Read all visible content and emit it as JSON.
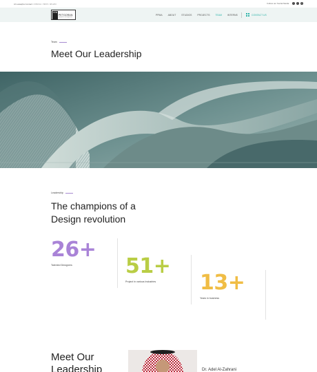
{
  "topbar": {
    "contact_label": "Al Lawaqha Contact:",
    "contact_number": "2350941 / 8835 / 981260",
    "social_label": "Follow our Social Media:",
    "social_icons": [
      "facebook-icon",
      "twitter-icon",
      "instagram-icon"
    ]
  },
  "navbar": {
    "logo_mark": "PPM",
    "logo_name": "PETGORAN",
    "logo_sub": "petgoran management",
    "items": [
      "PPMA",
      "ABOUT",
      "STUDIOS",
      "PROJECTS",
      "TEAM",
      "INTERNS"
    ],
    "active_item": "TEAM",
    "contact_button": "CONTACT US",
    "accent_color": "#2bb3a8"
  },
  "page": {
    "eyebrow": "Team",
    "title": "Meet Our Leadership"
  },
  "leadership": {
    "eyebrow": "Leadership",
    "heading": "The champions of a Design revolution",
    "stats": [
      {
        "value": "26+",
        "label": "Talented Designers",
        "color": "#a983d7"
      },
      {
        "value": "51+",
        "label": "Project in various Industries",
        "color": "#b9cd45"
      },
      {
        "value": "13+",
        "label": "Years in business",
        "color": "#f0bd45"
      }
    ]
  },
  "leaders_section": {
    "heading": "Meet Our Leadership",
    "first_leader_name": "Dr. Adel Al-Zahrani"
  }
}
